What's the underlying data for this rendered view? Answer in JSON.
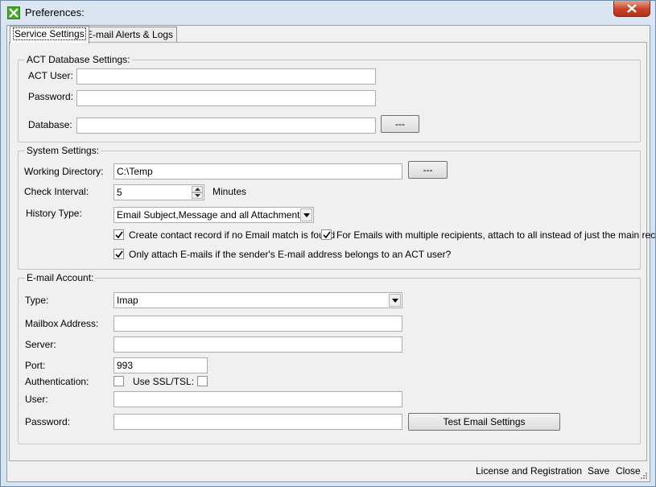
{
  "window": {
    "title": "Preferences:"
  },
  "tabs": [
    {
      "label": "Service Settings"
    },
    {
      "label": "E-mail Alerts & Logs"
    }
  ],
  "act_db": {
    "group_title": "ACT Database Settings:",
    "user_label": "ACT User:",
    "user_value": "",
    "password_label": "Password:",
    "password_value": "",
    "database_label": "Database:",
    "database_value": "",
    "browse_label": "---"
  },
  "system": {
    "group_title": "System Settings:",
    "working_dir_label": "Working Directory:",
    "working_dir_value": "C:\\Temp",
    "browse_label": "---",
    "interval_label": "Check Interval:",
    "interval_value": "5",
    "interval_unit": "Minutes",
    "history_label": "History Type:",
    "history_value": "Email Subject,Message and all Attachments",
    "create_contact_label": "Create contact record if no Email match is found",
    "create_contact_checked": true,
    "multi_recipient_label": "For Emails with multiple recipients, attach to all instead of just the main recipient",
    "multi_recipient_checked": true,
    "only_attach_label": "Only attach E-mails if the sender's E-mail address belongs to an ACT user?",
    "only_attach_checked": true
  },
  "email": {
    "group_title": "E-mail Account:",
    "type_label": "Type:",
    "type_value": "Imap",
    "mailbox_label": "Mailbox Address:",
    "mailbox_value": "",
    "server_label": "Server:",
    "server_value": "",
    "port_label": "Port:",
    "port_value": "993",
    "auth_label": "Authentication:",
    "auth_checked": false,
    "ssl_label": "Use SSL/TSL:",
    "ssl_checked": false,
    "user_label": "User:",
    "user_value": "",
    "password_label": "Password:",
    "password_value": "",
    "test_button": "Test Email Settings"
  },
  "footer": {
    "license": "License and Registration",
    "save": "Save",
    "close": "Close"
  },
  "icons": {
    "app": "app-logo-icon",
    "close": "close-icon",
    "dropdown": "chevron-down-icon"
  },
  "colors": {
    "titlebar": "#dbe6f2",
    "close_button": "#c7432a",
    "app_icon": "#4aa92c"
  }
}
